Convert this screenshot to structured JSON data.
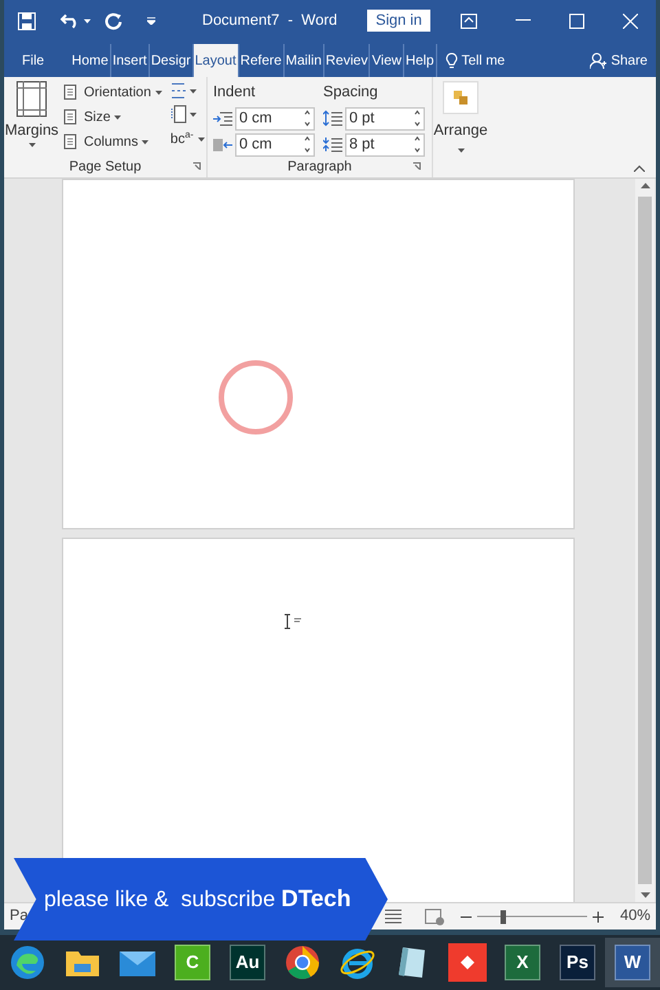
{
  "window": {
    "title": "Document7  -  Word",
    "sign_in": "Sign in"
  },
  "tabs": [
    {
      "label": "File",
      "selected": false
    },
    {
      "label": "Home",
      "selected": false
    },
    {
      "label": "Insert",
      "selected": false
    },
    {
      "label": "Desigr",
      "selected": false
    },
    {
      "label": "Layout",
      "selected": true
    },
    {
      "label": "Refere",
      "selected": false
    },
    {
      "label": "Mailin",
      "selected": false
    },
    {
      "label": "Reviev",
      "selected": false
    },
    {
      "label": "View",
      "selected": false
    },
    {
      "label": "Help",
      "selected": false
    }
  ],
  "tell_me": "Tell me",
  "share": "Share",
  "page_setup": {
    "margins": "Margins",
    "orientation": "Orientation",
    "size": "Size",
    "columns": "Columns",
    "hyphenation_base": "bc",
    "hyphenation_raised": "a-",
    "group_label": "Page Setup"
  },
  "paragraph": {
    "indent_label": "Indent",
    "spacing_label": "Spacing",
    "indent_left": "0 cm",
    "indent_right": "0 cm",
    "spacing_before": "0 pt",
    "spacing_after": "8 pt",
    "group_label": "Paragraph"
  },
  "arrange": {
    "label": "Arrange"
  },
  "status_bar": {
    "page": "Pa",
    "zoom": "40%",
    "level": 0.24
  },
  "banner": {
    "text": "please like &  subscribe",
    "brand": "DTech"
  },
  "taskbar": [
    {
      "kind": "edge",
      "selected": false
    },
    {
      "kind": "folder",
      "selected": false
    },
    {
      "kind": "mail",
      "selected": false
    },
    {
      "kind": "letter",
      "label": "C",
      "color": "#4caf1f",
      "selected": false
    },
    {
      "kind": "letter",
      "label": "Au",
      "color": "#00332e",
      "selected": false
    },
    {
      "kind": "chrome",
      "selected": false
    },
    {
      "kind": "ie",
      "selected": false
    },
    {
      "kind": "note",
      "selected": false
    },
    {
      "kind": "remote",
      "selected": false
    },
    {
      "kind": "letter",
      "label": "X",
      "color": "#1d6b3c",
      "selected": false
    },
    {
      "kind": "letter",
      "label": "Ps",
      "color": "#0a1f3a",
      "selected": false
    },
    {
      "kind": "letter",
      "label": "W",
      "color": "#2b579a",
      "selected": true
    }
  ]
}
